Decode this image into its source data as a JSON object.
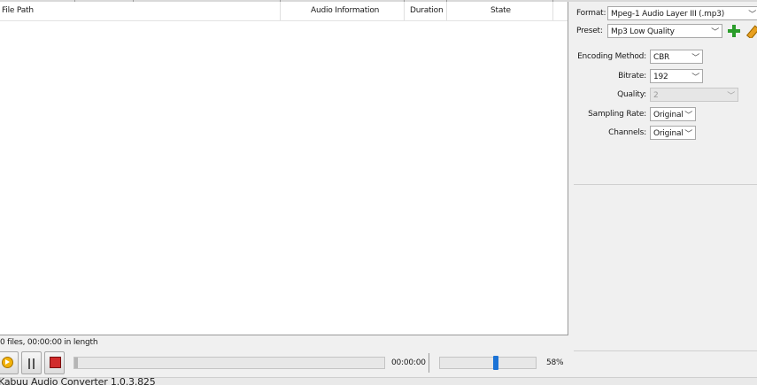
{
  "file_list": {
    "columns": [
      {
        "key": "path",
        "label": "File Path"
      },
      {
        "key": "audio",
        "label": "Audio Information"
      },
      {
        "key": "duration",
        "label": "Duration"
      },
      {
        "key": "state",
        "label": "State"
      }
    ],
    "rows": []
  },
  "summary": {
    "text": "0 files, 00:00:00 in length"
  },
  "transport": {
    "play_icon": "play-icon",
    "pause_icon": "pause-icon",
    "stop_icon": "stop-icon",
    "progress": 0.01,
    "time": "00:00:00",
    "volume": 0.58,
    "volume_label": "58%"
  },
  "status": {
    "text": "Kabuu Audio Converter 1.0.3.825"
  },
  "settings": {
    "format": {
      "label": "Format:",
      "value": "Mpeg-1 Audio Layer III (.mp3)"
    },
    "preset": {
      "label": "Preset:",
      "value": "Mp3 Low Quality"
    },
    "encoding_method": {
      "label": "Encoding Method:",
      "value": "CBR"
    },
    "bitrate": {
      "label": "Bitrate:",
      "value": "192"
    },
    "quality": {
      "label": "Quality:",
      "value": "2"
    },
    "sampling_rate": {
      "label": "Sampling Rate:",
      "value": "Original"
    },
    "channels": {
      "label": "Channels:",
      "value": "Original"
    }
  },
  "colors": {
    "play": "#f2b20a",
    "stop": "#d12b2b",
    "volume_thumb": "#1c73d6",
    "add": "#2a9c2a",
    "edit": "#e8a020"
  }
}
